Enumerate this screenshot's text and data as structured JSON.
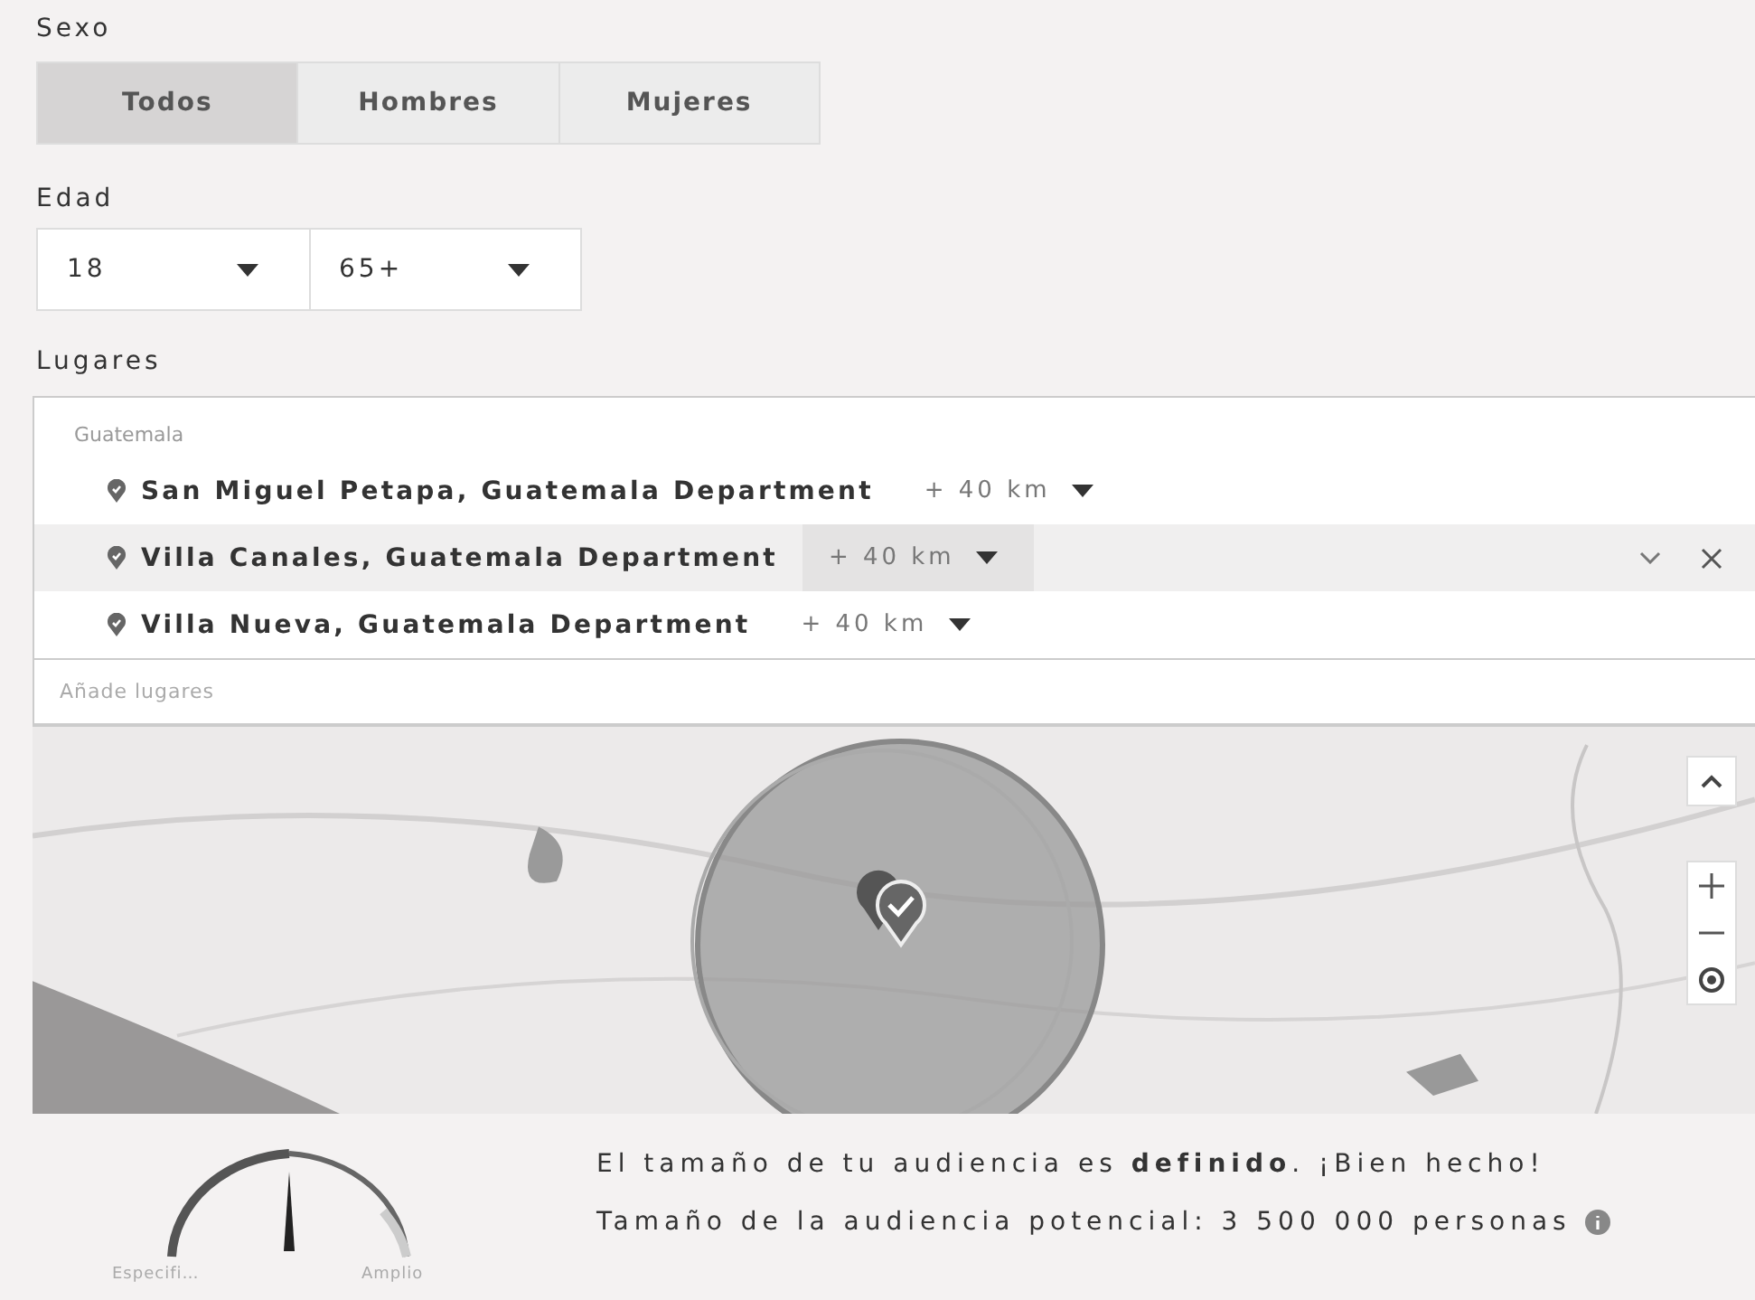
{
  "sex": {
    "label": "Sexo",
    "options": [
      {
        "label": "Todos",
        "selected": true
      },
      {
        "label": "Hombres",
        "selected": false
      },
      {
        "label": "Mujeres",
        "selected": false
      }
    ]
  },
  "age": {
    "label": "Edad",
    "selects": [
      {
        "value": "18"
      },
      {
        "value": "65+"
      }
    ]
  },
  "places": {
    "label": "Lugares",
    "country": "Guatemala",
    "placeholder": "Añade lugares",
    "items": [
      {
        "name": "San Miguel Petapa, Guatemala Department",
        "radius": "+ 40 km",
        "hovered": false
      },
      {
        "name": "Villa Canales, Guatemala Department",
        "radius": "+ 40 km",
        "hovered": true
      },
      {
        "name": "Villa Nueva, Guatemala Department",
        "radius": "+ 40 km",
        "hovered": false
      }
    ]
  },
  "audience": {
    "gauge": {
      "level": 0.5,
      "min_label": "Especifi…",
      "max_label": "Amplio"
    },
    "message": "El tamaño de tu audiencia es **definido**. ¡Bien hecho!",
    "size": "Tamaño de la audiencia potencial: 3 500 000 personas"
  }
}
